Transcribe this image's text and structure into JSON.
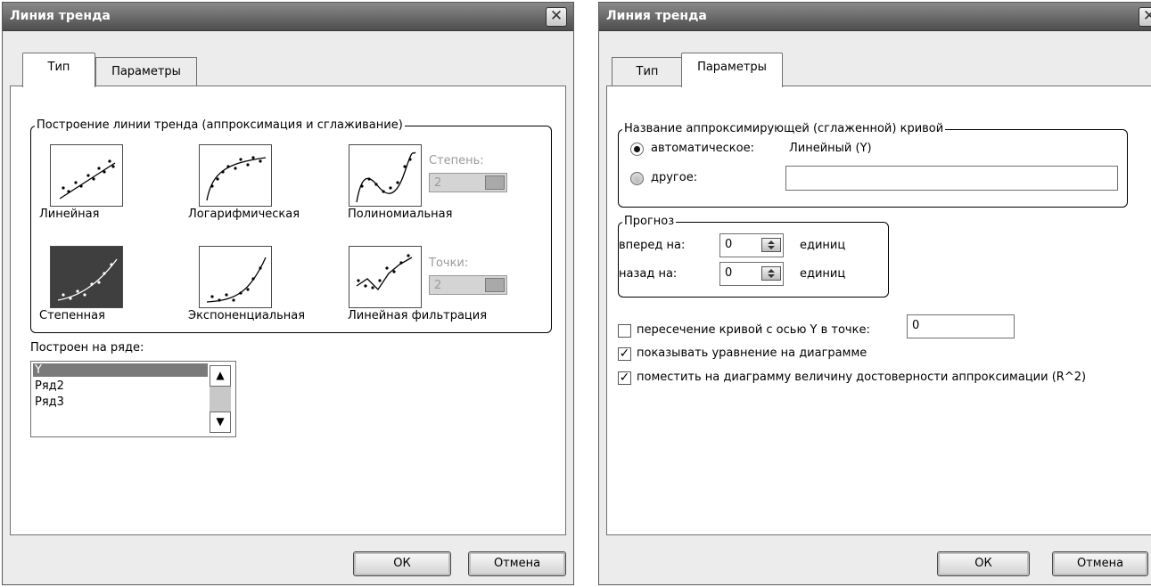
{
  "dialog_left": {
    "title": "Линия тренда",
    "tabs": [
      "Тип",
      "Параметры"
    ],
    "active_tab": "Тип",
    "group_title": "Построение линии тренда (аппроксимация и сглаживание)",
    "trend_types": [
      {
        "label": "Линейная"
      },
      {
        "label": "Логарифмическая"
      },
      {
        "label": "Полиномиальная"
      },
      {
        "label": "Степенная",
        "selected": true
      },
      {
        "label": "Экспоненциальная"
      },
      {
        "label": "Линейная фильтрация"
      }
    ],
    "degree": {
      "label": "Степень:",
      "value": "2"
    },
    "points": {
      "label": "Точки:",
      "value": "2"
    },
    "series_label": "Построен на ряде:",
    "series": [
      "Y",
      "Ряд2",
      "Ряд3"
    ],
    "selected_series": "Y",
    "ok_label": "ОК",
    "cancel_label": "Отмена"
  },
  "dialog_right": {
    "title": "Линия тренда",
    "tabs": [
      "Тип",
      "Параметры"
    ],
    "active_tab": "Параметры",
    "name_group_title": "Название аппроксимирующей (сглаженной) кривой",
    "auto_label": "автоматическое:",
    "auto_value": "Линейный (Y)",
    "other_label": "другое:",
    "other_value": "",
    "forecast_group_title": "Прогноз",
    "forward_label": "вперед на:",
    "forward_value": "0",
    "backward_label": "назад на:",
    "backward_value": "0",
    "units_label": "единиц",
    "intercept_label": "пересечение кривой с осью Y в точке:",
    "intercept_checked": false,
    "intercept_value": "0",
    "show_equation_label": "показывать уравнение на диаграмме",
    "show_equation_checked": true,
    "show_r2_label": "поместить на диаграмму величину достоверности аппроксимации (R^2)",
    "show_r2_checked": true,
    "ok_label": "ОК",
    "cancel_label": "Отмена"
  },
  "colors": {
    "titlebar": "#5e5e5e",
    "selected_thumb": "#3f3f3f",
    "face": "#ececec"
  }
}
